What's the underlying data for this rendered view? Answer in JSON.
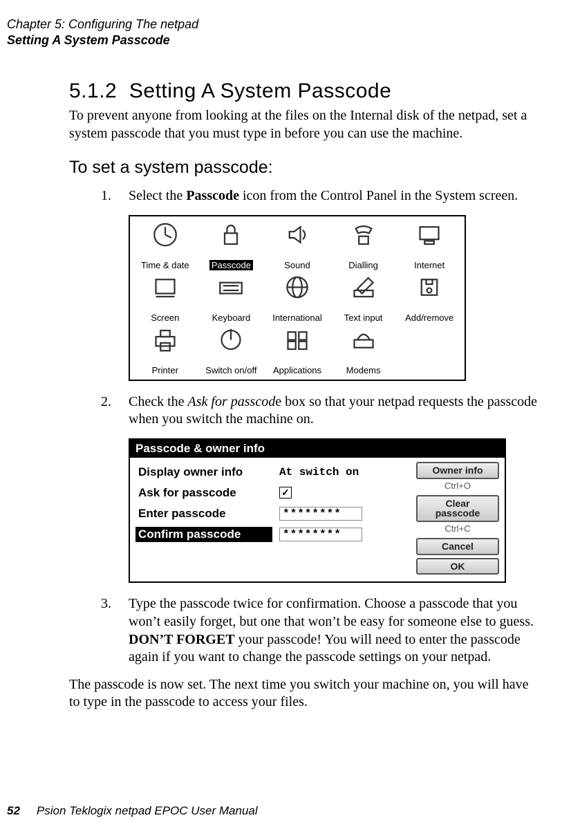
{
  "header": {
    "line1": "Chapter 5:  Configuring The netpad",
    "line2": "Setting A System Passcode"
  },
  "section": {
    "number": "5.1.2",
    "title": "Setting A System Passcode",
    "intro": "To prevent anyone from looking at the files on the Internal disk of the netpad, set a system passcode that you must type in before you can use the machine.",
    "subhead": "To set a system passcode:",
    "step1_num": "1.",
    "step1_pre": "Select the ",
    "step1_bold": "Passcode",
    "step1_post": " icon from the Control Panel in the System screen.",
    "step2_num": "2.",
    "step2_pre": "Check the ",
    "step2_em": "Ask for passcod",
    "step2_post": "e box so that your netpad requests the pass­code when you switch the machine on.",
    "step3_num": "3.",
    "step3_pre": "Type the passcode twice for confirmation. Choose a passcode that you won’t easily forget, but one that won’t be easy for someone else to guess. ",
    "step3_bold": "DON’T FORGET",
    "step3_post": " your passcode! You will need to enter the passcode again if you want to change the passcode settings on your netpad.",
    "closing": "The passcode is now set. The next time you switch your machine on, you will have to type in the passcode to access your files."
  },
  "control_panel": {
    "items": [
      {
        "label": "Time & date",
        "icon": "clock-icon",
        "selected": false
      },
      {
        "label": "Passcode",
        "icon": "lock-icon",
        "selected": true
      },
      {
        "label": "Sound",
        "icon": "speaker-icon",
        "selected": false
      },
      {
        "label": "Dialling",
        "icon": "phone-icon",
        "selected": false
      },
      {
        "label": "Internet",
        "icon": "computer-icon",
        "selected": false
      },
      {
        "label": "Screen",
        "icon": "screen-icon",
        "selected": false
      },
      {
        "label": "Keyboard",
        "icon": "keyboard-icon",
        "selected": false
      },
      {
        "label": "International",
        "icon": "globe-icon",
        "selected": false
      },
      {
        "label": "Text input",
        "icon": "pen-icon",
        "selected": false
      },
      {
        "label": "Add/remove",
        "icon": "disk-icon",
        "selected": false
      },
      {
        "label": "Printer",
        "icon": "printer-icon",
        "selected": false
      },
      {
        "label": "Switch on/off",
        "icon": "switch-icon",
        "selected": false
      },
      {
        "label": "Applications",
        "icon": "apps-icon",
        "selected": false
      },
      {
        "label": "Modems",
        "icon": "modem-icon",
        "selected": false
      }
    ]
  },
  "dialog": {
    "title": "Passcode & owner info",
    "rows": {
      "display_owner": {
        "label": "Display owner info",
        "value": "At switch on"
      },
      "ask": {
        "label": "Ask for passcode",
        "checked": true,
        "checkmark": "✓"
      },
      "enter": {
        "label": "Enter passcode",
        "value": "********"
      },
      "confirm": {
        "label": "Confirm passcode",
        "value": "********"
      }
    },
    "buttons": {
      "owner": {
        "label": "Owner info",
        "shortcut": "Ctrl+O"
      },
      "clear": {
        "label": "Clear passcode",
        "shortcut": "Ctrl+C"
      },
      "cancel": {
        "label": "Cancel"
      },
      "ok": {
        "label": "OK"
      }
    }
  },
  "footer": {
    "page": "52",
    "book": "Psion Teklogix netpad EPOC User Manual"
  }
}
